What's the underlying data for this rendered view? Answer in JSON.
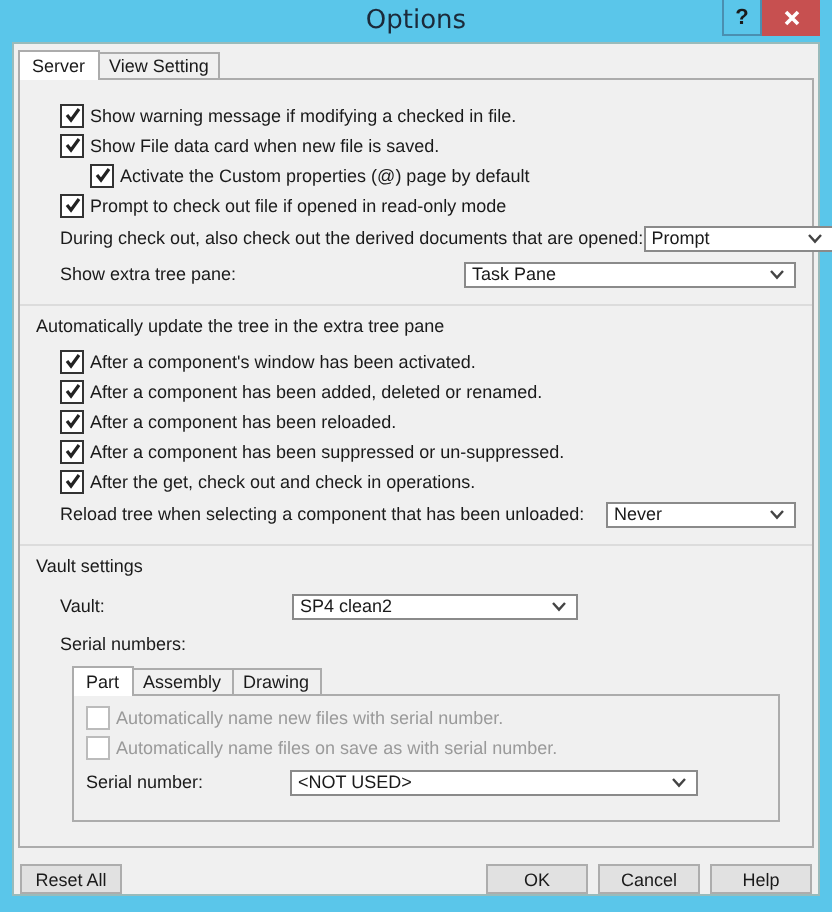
{
  "window": {
    "title": "Options",
    "help_button": "?"
  },
  "tabs": [
    {
      "label": "Server",
      "selected": true
    },
    {
      "label": "View Setting",
      "selected": false
    }
  ],
  "general": {
    "checkboxes": [
      {
        "label": "Show warning message if modifying a checked in file.",
        "checked": true
      },
      {
        "label": "Show File data card when new file is saved.",
        "checked": true,
        "children": [
          {
            "label": "Activate the Custom properties (@) page by default",
            "checked": true
          }
        ]
      },
      {
        "label": "Prompt to check out file if opened in read-only mode",
        "checked": true
      }
    ],
    "dropdowns": [
      {
        "label": "During check out, also check out the derived documents that are opened:",
        "value": "Prompt"
      },
      {
        "label": "Show extra tree pane:",
        "value": "Task Pane"
      }
    ]
  },
  "tree_update": {
    "title": "Automatically update the tree in the extra tree pane",
    "checkboxes": [
      {
        "label": "After a component's window has been activated.",
        "checked": true
      },
      {
        "label": "After a component has been added, deleted or renamed.",
        "checked": true
      },
      {
        "label": "After a component has been reloaded.",
        "checked": true
      },
      {
        "label": "After a component has been suppressed or un-suppressed.",
        "checked": true
      },
      {
        "label": "After the get, check out and check in operations.",
        "checked": true
      }
    ],
    "dropdown": {
      "label": "Reload tree when selecting a component that has been unloaded:",
      "value": "Never"
    }
  },
  "vault_settings": {
    "title": "Vault settings",
    "vault": {
      "label": "Vault:",
      "value": "SP4 clean2"
    },
    "serial_numbers": {
      "label": "Serial numbers:",
      "tabs": [
        {
          "label": "Part",
          "selected": true
        },
        {
          "label": "Assembly",
          "selected": false
        },
        {
          "label": "Drawing",
          "selected": false
        }
      ],
      "checkboxes": [
        {
          "label": "Automatically name new files with serial number.",
          "checked": false,
          "disabled": true
        },
        {
          "label": "Automatically name files on save as with serial number.",
          "checked": false,
          "disabled": true
        }
      ],
      "serial_number": {
        "label": "Serial number:",
        "value": "<NOT USED>"
      }
    }
  },
  "buttons": [
    "Reset All",
    "OK",
    "Cancel",
    "Help"
  ]
}
